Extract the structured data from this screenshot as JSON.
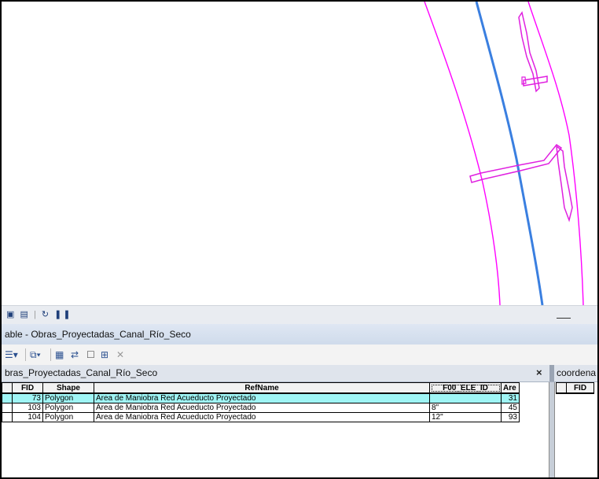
{
  "map": {
    "colors": {
      "boundary": "#ff00ff",
      "centerline": "#3a7fe0",
      "features": "#e020e0"
    }
  },
  "statusbar": {
    "icons": [
      "layout-view-icon",
      "data-view-icon",
      "refresh-icon",
      "pause-icon"
    ]
  },
  "table_window": {
    "title": "able - Obras_Proyectadas_Canal_Río_Seco",
    "toolbar_icons": [
      "table-options-icon",
      "related-tables-icon",
      "select-by-attributes-icon",
      "switch-selection-icon",
      "clear-selection-icon",
      "delete-selected-icon"
    ],
    "tabs": [
      {
        "label": "bras_Proyectadas_Canal_Río_Seco",
        "close": "×"
      },
      {
        "label": "coordena"
      }
    ],
    "columns": [
      "FID",
      "Shape",
      "RefName",
      "F00_ELE_ID",
      "Are"
    ],
    "rows": [
      {
        "fid": "73",
        "shape": "Polygon",
        "refname": "Área de Maniobra Red Acueducto Proyectado",
        "f00": "",
        "area": "31",
        "selected": true
      },
      {
        "fid": "103",
        "shape": "Polygon",
        "refname": "Área de Maniobra Red Acueducto Proyectado",
        "f00": "8\"",
        "area": "45",
        "selected": false
      },
      {
        "fid": "104",
        "shape": "Polygon",
        "refname": "Área de Maniobra Red Acueducto Proyectado",
        "f00": "12\"",
        "area": "93",
        "selected": false
      }
    ],
    "second_table_columns": [
      "FID"
    ]
  }
}
